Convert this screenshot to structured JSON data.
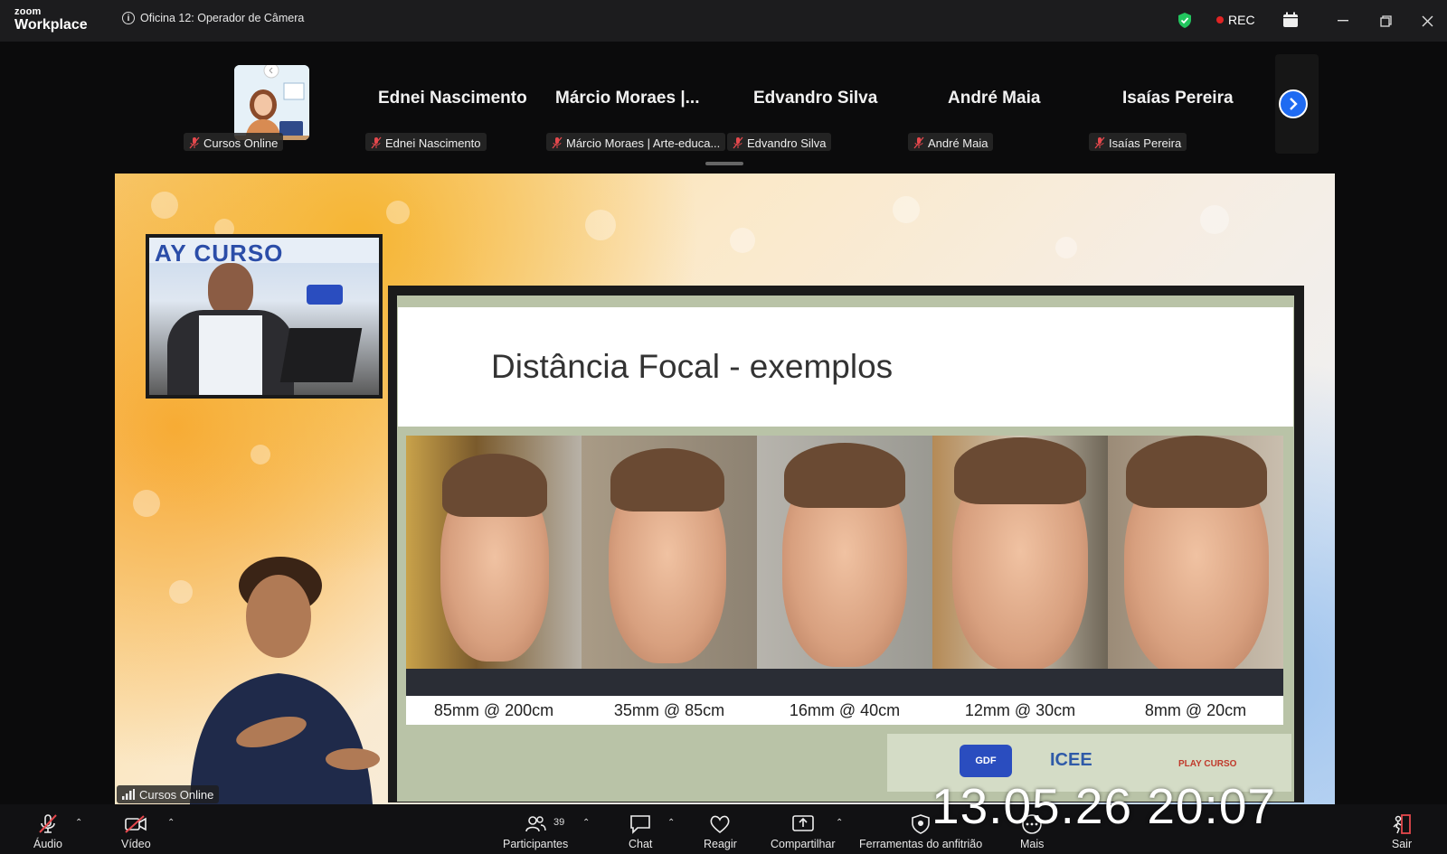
{
  "app": {
    "logo_line1": "zoom",
    "logo_line2": "Workplace",
    "meeting_title": "Oficina 12: Operador de Câmera",
    "rec_label": "REC"
  },
  "participants": [
    {
      "big_name": "",
      "tag": "Cursos Online",
      "has_avatar": true
    },
    {
      "big_name": "Ednei Nascimento",
      "tag": "Ednei Nascimento"
    },
    {
      "big_name": "Márcio  Moraes |...",
      "tag": "Márcio Moraes | Arte-educa..."
    },
    {
      "big_name": "Edvandro Silva",
      "tag": "Edvandro Silva"
    },
    {
      "big_name": "André Maia",
      "tag": "André Maia"
    },
    {
      "big_name": "Isaías Pereira",
      "tag": "Isaías Pereira"
    }
  ],
  "share": {
    "slide_title": "Distância Focal - exemplos",
    "captions": [
      "85mm @ 200cm",
      "35mm @ 85cm",
      "16mm @ 40cm",
      "12mm @ 30cm",
      "8mm @ 20cm"
    ],
    "logo_gdf": "GDF",
    "logo_icee": "ICEE",
    "logo_play": "PLAY CURSO",
    "pip_banner": "AY CURSO",
    "presenter_tag": "Cursos Online"
  },
  "toolbar": {
    "audio": "Áudio",
    "video": "Vídeo",
    "participants": "Participantes",
    "participants_count": "39",
    "chat": "Chat",
    "react": "Reagir",
    "share": "Compartilhar",
    "host_tools": "Ferramentas do anfitrião",
    "more": "Mais",
    "leave": "Sair"
  },
  "overlay": {
    "timestamp": "13.05.26 20:07"
  },
  "colors": {
    "accent_blue": "#1f6bf2",
    "rec_red": "#e02424",
    "shield_green": "#22c55e",
    "leave_red": "#e5484d"
  }
}
